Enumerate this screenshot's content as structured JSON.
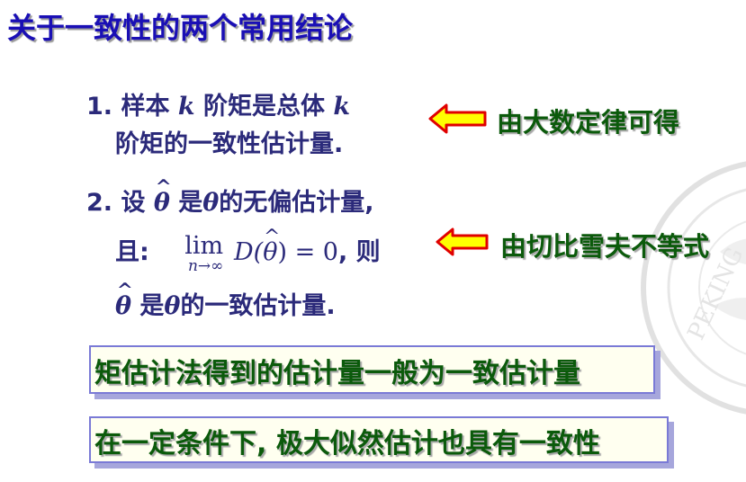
{
  "title": "关于一致性的两个常用结论",
  "item1": {
    "number": "1.",
    "line1_a": "样本",
    "k": "k",
    "line1_b": "阶矩是总体",
    "line2": "阶矩的一致性估计量."
  },
  "item2": {
    "number": "2.",
    "line1_a": "设",
    "theta": "θ",
    "line1_b": "是",
    "line1_c": "的无偏估计量,",
    "line2_a": "且:",
    "lim": "lim",
    "lim_sub": "n→∞",
    "expr_d": "D(",
    "expr_end": ") = 0",
    "line2_b": ", 则",
    "line3_a": "是",
    "line3_b": "的一致估计量."
  },
  "note1": "由大数定律可得",
  "note2": "由切比雪夫不等式",
  "box1": "矩估计法得到的估计量一般为一致估计量",
  "box2": "在一定条件下, 极大似然估计也具有一致性",
  "seal_text": "PEKING",
  "colors": {
    "title": "#1a0fb5",
    "body_text": "#2b2a7a",
    "note_text": "#0b5a0b",
    "arrow_fill": "#ffff00",
    "arrow_stroke": "#e00000",
    "box_border": "#7a7ad6",
    "box_bg": "#fffff0"
  },
  "icons": [
    "left-arrow-icon",
    "university-seal-watermark"
  ]
}
